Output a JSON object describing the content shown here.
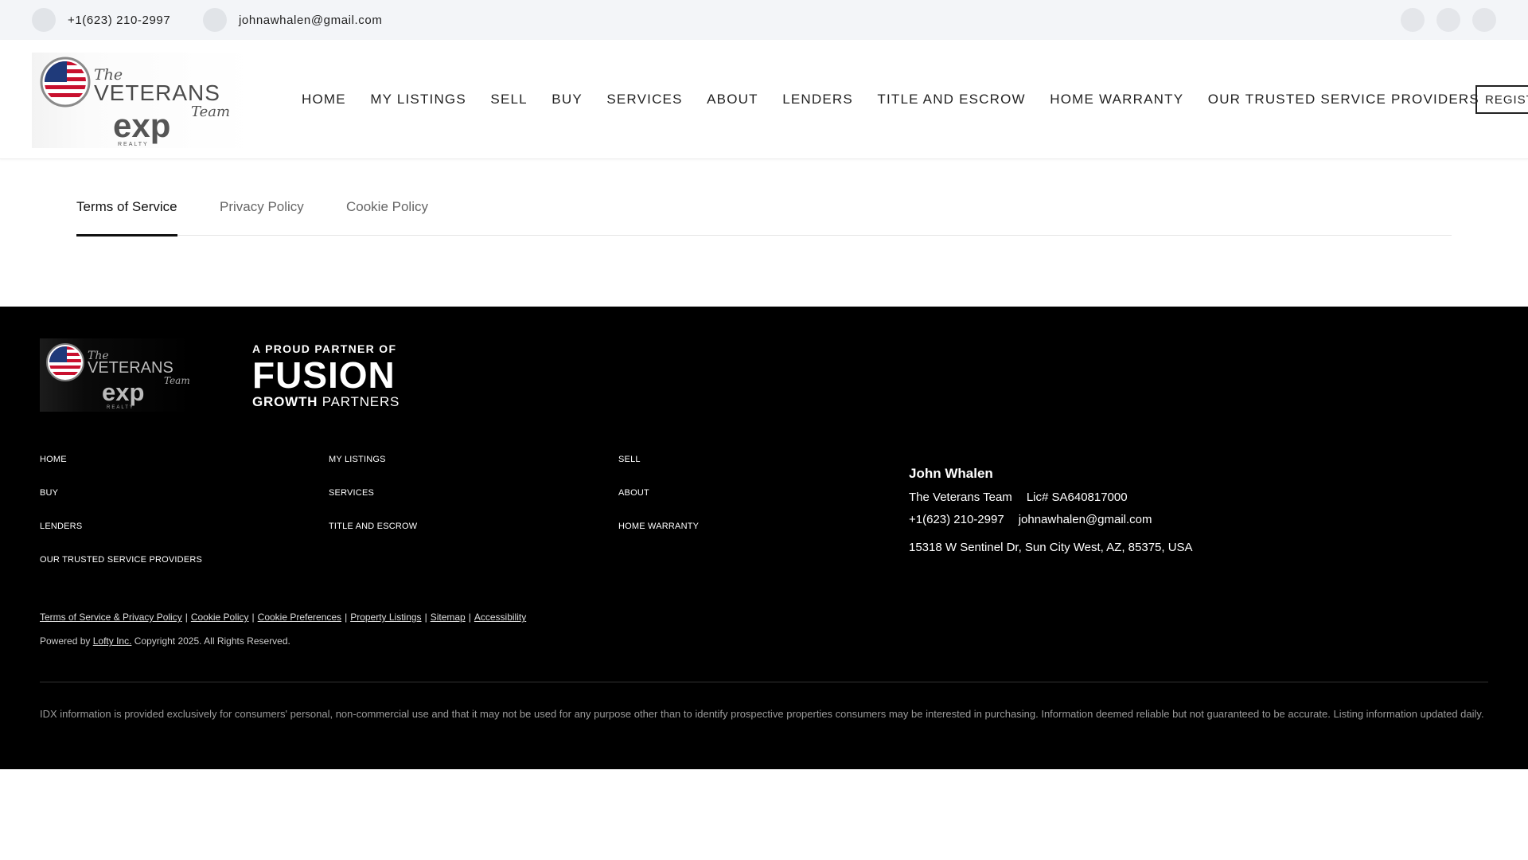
{
  "topbar": {
    "phone": "+1(623) 210-2997",
    "email": "johnawhalen@gmail.com",
    "social": [
      "social-icon-1",
      "social-icon-2",
      "social-icon-3"
    ]
  },
  "header": {
    "nav": [
      "HOME",
      "MY LISTINGS",
      "SELL",
      "BUY",
      "SERVICES",
      "ABOUT",
      "LENDERS",
      "TITLE AND ESCROW",
      "HOME WARRANTY",
      "OUR TRUSTED SERVICE PROVIDERS"
    ],
    "register_label": "REGISTER",
    "logo": {
      "line1": "The",
      "line2": "VETERANS",
      "line3": "Team",
      "brand": "exp",
      "brand_sub": "REALTY"
    }
  },
  "tabs": [
    {
      "label": "Terms of Service",
      "active": true
    },
    {
      "label": "Privacy Policy",
      "active": false
    },
    {
      "label": "Cookie Policy",
      "active": false
    }
  ],
  "footer": {
    "logo": {
      "line1": "The",
      "line2": "VETERANS",
      "line3": "Team",
      "brand": "exp",
      "brand_sub": "REALTY"
    },
    "partner": {
      "line1": "A PROUD PARTNER OF",
      "line2": "FUSION",
      "line3a": "GROWTH",
      "line3b": " PARTNERS"
    },
    "links": {
      "col1": [
        "HOME",
        "BUY",
        "LENDERS",
        "OUR TRUSTED SERVICE PROVIDERS"
      ],
      "col2": [
        "MY LISTINGS",
        "SERVICES",
        "TITLE AND ESCROW"
      ],
      "col3": [
        "SELL",
        "ABOUT",
        "HOME WARRANTY"
      ]
    },
    "agent": {
      "name": "John Whalen",
      "team": "The Veterans Team",
      "license": "Lic# SA640817000",
      "phone": "+1(623) 210-2997",
      "email": "johnawhalen@gmail.com",
      "address": "15318 W Sentinel Dr, Sun City West, AZ, 85375, USA"
    },
    "legal_links": [
      "Terms of Service & Privacy Policy",
      "Cookie Policy",
      "Cookie Preferences",
      "Property Listings",
      "Sitemap",
      "Accessibility"
    ],
    "powered_prefix": "Powered by",
    "powered_link": "Lofty Inc.",
    "copyright": "Copyright 2025. All Rights Reserved.",
    "idx": "IDX information is provided exclusively for consumers' personal, non-commercial use and that it may not be used for any purpose other than to identify prospective properties consumers may be interested in purchasing. Information deemed reliable but not guaranteed to be accurate. Listing information updated daily."
  },
  "colors": {
    "footer_bg": "#000000",
    "topbar_bg": "#f3f5f8",
    "flag_red": "#c8102e",
    "flag_blue": "#1f3a7a"
  }
}
